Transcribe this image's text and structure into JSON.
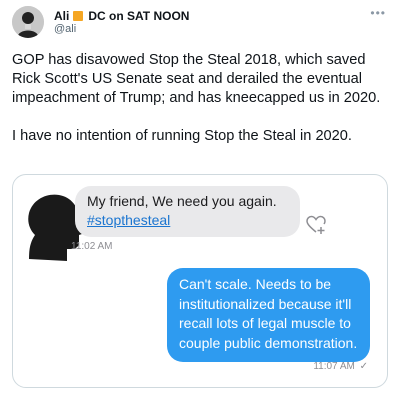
{
  "author": {
    "name": "Ali",
    "badge": "DC on SAT NOON",
    "handle": "@ali",
    "flag_color": "#f5a623"
  },
  "tweet": {
    "paragraph1": "GOP has disavowed Stop the Steal 2018, which saved Rick Scott's US Senate seat and derailed the eventual impeachment of Trump; and has kneecapped us in 2020.",
    "paragraph2": "I have no intention of running Stop the Steal in 2020."
  },
  "chat": {
    "incoming": {
      "text": "My friend, We need you again.",
      "hashtag": "#stopthesteal",
      "time": "11:02 AM"
    },
    "outgoing": {
      "text": "Can't scale. Needs to be institutionalized because it'll recall lots of legal muscle to couple public demonstration.",
      "time": "11:07 AM"
    }
  },
  "icons": {
    "more": "more-icon",
    "heart": "heart-plus-icon",
    "speaker": "speaking-head-icon",
    "read_check": "check-icon"
  },
  "colors": {
    "incoming_bubble": "#e9e9eb",
    "outgoing_bubble": "#2e9bf0",
    "hashtag": "#1b75d0"
  }
}
